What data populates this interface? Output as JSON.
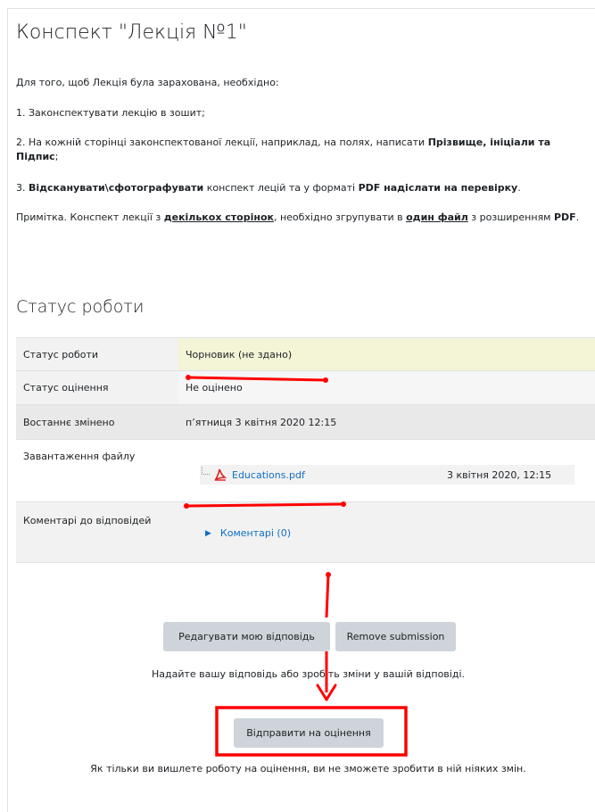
{
  "assignment": {
    "title": "Конспект \"Лекція №1\"",
    "intro": "Для того, щоб Лекція була зарахована, необхідно:",
    "step1": "1. Законспектувати лекцію в зошит;",
    "step2_pre": "2. На кожній сторінці законспектованої лекції, наприклад, на полях, написати ",
    "step2_bold": "Прізвище, ініціали та Підпис",
    "step2_post": ";",
    "step3_num": "3. ",
    "step3_bold1": "Відсканувати\\сфотографувати",
    "step3_mid": " конспект лецій та у форматі ",
    "step3_bold2": "PDF надіслати на перевірку",
    "step3_post": ".",
    "note_pre": "Примітка. Конспект лекції з ",
    "note_bu1": "декількох сторінок",
    "note_mid": ", необхідно згрупувати в ",
    "note_bu2": "один файл",
    "note_mid2": " з розширенням ",
    "note_bold": "PDF",
    "note_post": "."
  },
  "status": {
    "heading": "Статус роботи",
    "rows": [
      {
        "label": "Статус роботи",
        "value": "Чорновик (не здано)"
      },
      {
        "label": "Статус оцінення",
        "value": "Не оцінено"
      },
      {
        "label": "Востаннє змінено",
        "value": "п’ятниця 3 квітня 2020 12:15"
      },
      {
        "label": "Завантаження файлу",
        "file_name": "Educations.pdf",
        "file_date": "3 квітня 2020, 12:15"
      },
      {
        "label": "Коментарі до відповідей",
        "comments_link": "Коментарі (0)"
      }
    ]
  },
  "actions": {
    "edit_label": "Редагувати мою відповідь",
    "remove_label": "Remove submission",
    "hint": "Надайте вашу відповідь або зробіть зміни у вашій відповіді.",
    "submit_label": "Відправити на оцінення",
    "warning": "Як тільки ви вишлете роботу на оцінення, ви не зможете зробити в ній ніяких змін."
  },
  "colors": {
    "link": "#0f6fc5",
    "annotation": "#ff0000",
    "draft_highlight": "#f4f4d6",
    "button": "#ced4da"
  }
}
